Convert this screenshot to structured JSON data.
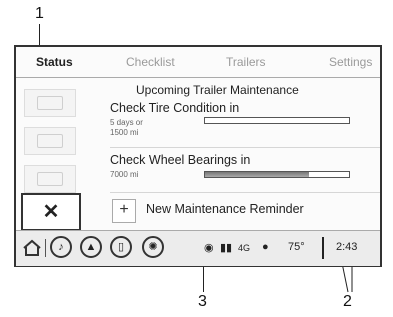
{
  "callouts": {
    "one": "1",
    "two": "2",
    "three": "3"
  },
  "tabs": [
    {
      "label": "Status",
      "active": true
    },
    {
      "label": "Checklist",
      "active": false
    },
    {
      "label": "Trailers",
      "active": false
    },
    {
      "label": "Settings",
      "active": false
    }
  ],
  "section_title": "Upcoming Trailer Maintenance",
  "items": [
    {
      "title": "Check Tire Condition in",
      "sub": [
        "5 days or",
        "1500 mi"
      ],
      "progress": 0.0
    },
    {
      "title": "Check Wheel Bearings in",
      "sub": [
        "7000 mi"
      ],
      "progress": 0.72
    }
  ],
  "add_reminder": {
    "plus": "+",
    "label": "New Maintenance Reminder"
  },
  "tools_icon": "wrench-screwdriver-icon",
  "tools_glyph": "✕",
  "status_bar": {
    "temperature": "75°",
    "time": "2:43",
    "network": "4G",
    "icons": [
      "home-icon",
      "audio-icon",
      "navigation-icon",
      "phone-icon",
      "apps-icon",
      "onstar-eye-icon",
      "signal-icon",
      "location-pin-icon"
    ]
  }
}
